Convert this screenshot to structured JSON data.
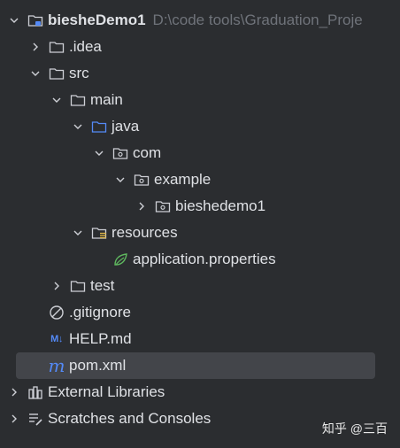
{
  "project": {
    "name": "biesheDemo1",
    "path": "D:\\code tools\\Graduation_Proje"
  },
  "tree": {
    "idea": ".idea",
    "src": "src",
    "main": "main",
    "java": "java",
    "com": "com",
    "example": "example",
    "biesheDemo1pkg": "bieshedemo1",
    "resources": "resources",
    "app_props": "application.properties",
    "test": "test",
    "gitignore": ".gitignore",
    "help_md": "HELP.md",
    "pom": "pom.xml",
    "external_libraries": "External Libraries",
    "scratches": "Scratches and Consoles"
  },
  "icons": {
    "md_badge": "M↓",
    "maven_badge": "m"
  },
  "watermark": "知乎 @三百",
  "colors": {
    "background": "#2b2d30",
    "selected_row": "#43454a",
    "text": "#dfe1e5",
    "path_text": "#6f737a",
    "folder_icon": "#ced0d6",
    "source_folder_icon": "#548af7",
    "spring_leaf": "#5fb85f"
  }
}
